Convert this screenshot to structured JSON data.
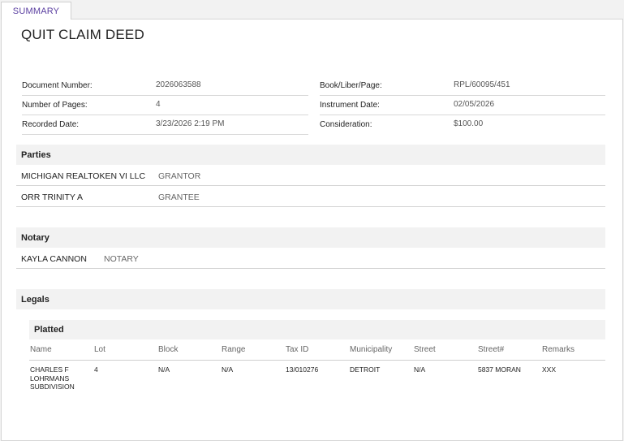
{
  "tabs": [
    {
      "label": "SUMMARY"
    }
  ],
  "document": {
    "title": "QUIT CLAIM DEED",
    "left_fields": [
      {
        "label": "Document Number:",
        "value": "2026063588"
      },
      {
        "label": "Number of Pages:",
        "value": "4"
      },
      {
        "label": "Recorded Date:",
        "value": "3/23/2026 2:19 PM"
      }
    ],
    "right_fields": [
      {
        "label": "Book/Liber/Page:",
        "value": "RPL/60095/451"
      },
      {
        "label": "Instrument Date:",
        "value": "02/05/2026"
      },
      {
        "label": "Consideration:",
        "value": "$100.00"
      }
    ]
  },
  "parties": {
    "heading": "Parties",
    "rows": [
      {
        "name": "MICHIGAN REALTOKEN VI LLC",
        "role": "GRANTOR"
      },
      {
        "name": "ORR TRINITY A",
        "role": "GRANTEE"
      }
    ]
  },
  "notary": {
    "heading": "Notary",
    "rows": [
      {
        "name": "KAYLA CANNON",
        "role": "NOTARY"
      }
    ]
  },
  "legals": {
    "heading": "Legals",
    "platted": {
      "heading": "Platted",
      "columns": [
        "Name",
        "Lot",
        "Block",
        "Range",
        "Tax ID",
        "Municipality",
        "Street",
        "Street#",
        "Remarks"
      ],
      "rows": [
        {
          "name": "CHARLES F LOHRMANS SUBDIVISION",
          "lot": "4",
          "block": "N/A",
          "range": "N/A",
          "tax_id": "13/010276",
          "municipality": "DETROIT",
          "street": "N/A",
          "street_no": "5837 MORAN",
          "remarks": "XXX"
        }
      ]
    }
  },
  "colors": {
    "tab_text": "#5a3ea0",
    "section_bg": "#f2f2f2"
  }
}
